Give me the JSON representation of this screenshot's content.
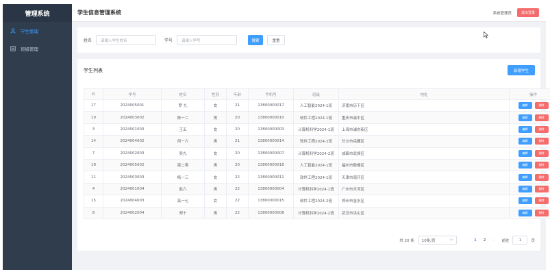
{
  "sidebar": {
    "brand": "管理系统",
    "items": [
      {
        "label": "学生管理",
        "icon": "user-icon"
      },
      {
        "label": "班级管理",
        "icon": "class-icon"
      }
    ]
  },
  "header": {
    "title": "学生信息管理系统",
    "user": "系统管理员",
    "logout": "退出登录"
  },
  "search": {
    "name_label": "姓名",
    "name_placeholder": "请输入学生姓名",
    "no_label": "学号",
    "no_placeholder": "请输入学号",
    "search_btn": "搜索",
    "reset_btn": "重置"
  },
  "list": {
    "title": "学生列表",
    "add_btn": "新增学生",
    "columns": [
      "ID",
      "学号",
      "姓名",
      "性别",
      "年龄",
      "手机号",
      "班级",
      "地址",
      "操作"
    ],
    "edit_label": "编辑",
    "delete_label": "删除",
    "rows": [
      {
        "id": "17",
        "no": "2024005001",
        "name": "罗 九",
        "gender": "女",
        "age": "21",
        "phone": "13800000017",
        "class": "人工智能2024-1班",
        "addr": "济南市历下区"
      },
      {
        "id": "10",
        "no": "2024003002",
        "name": "陈一二",
        "gender": "男",
        "age": "20",
        "phone": "13800000010",
        "class": "软件工程2024-1班",
        "addr": "重庆市渝中区"
      },
      {
        "id": "3",
        "no": "2024001003",
        "name": "王五",
        "gender": "女",
        "age": "20",
        "phone": "13800000003",
        "class": "计算机科学2024-1班",
        "addr": "上海市浦东新区"
      },
      {
        "id": "14",
        "no": "2024004002",
        "name": "何一六",
        "gender": "男",
        "age": "21",
        "phone": "13800000014",
        "class": "软件工程2024-2班",
        "addr": "长沙市岳麓区"
      },
      {
        "id": "7",
        "no": "2024002003",
        "name": "吴九",
        "gender": "女",
        "age": "20",
        "phone": "13800000007",
        "class": "计算机科学2024-2班",
        "addr": "成都市武侯区"
      },
      {
        "id": "18",
        "no": "2024005002",
        "name": "梁二零",
        "gender": "男",
        "age": "20",
        "phone": "13800000018",
        "class": "人工智能2024-1班",
        "addr": "福州市鼓楼区"
      },
      {
        "id": "11",
        "no": "2024003003",
        "name": "杨一三",
        "gender": "女",
        "age": "22",
        "phone": "13800000011",
        "class": "软件工程2024-1班",
        "addr": "天津市南开区"
      },
      {
        "id": "4",
        "no": "2024001004",
        "name": "赵六",
        "gender": "男",
        "age": "22",
        "phone": "13800000004",
        "class": "计算机科学2024-1班",
        "addr": "广州市天河区"
      },
      {
        "id": "15",
        "no": "2024004003",
        "name": "高一七",
        "gender": "女",
        "age": "22",
        "phone": "13800000015",
        "class": "软件工程2024-2班",
        "addr": "郑州市金水区"
      },
      {
        "id": "8",
        "no": "2024002004",
        "name": "郑十",
        "gender": "男",
        "age": "22",
        "phone": "13800000008",
        "class": "计算机科学2024-2班",
        "addr": "武汉市洪山区"
      }
    ]
  },
  "pagination": {
    "total": "共 20 条",
    "page_size": "10条/页",
    "prev": "‹",
    "pages": [
      "1",
      "2"
    ],
    "next": "›",
    "goto_label": "前往",
    "goto_value": "1",
    "goto_suffix": "页"
  },
  "colors": {
    "primary": "#409eff",
    "danger": "#f56c6c",
    "sidebar": "#2f3d4d"
  }
}
